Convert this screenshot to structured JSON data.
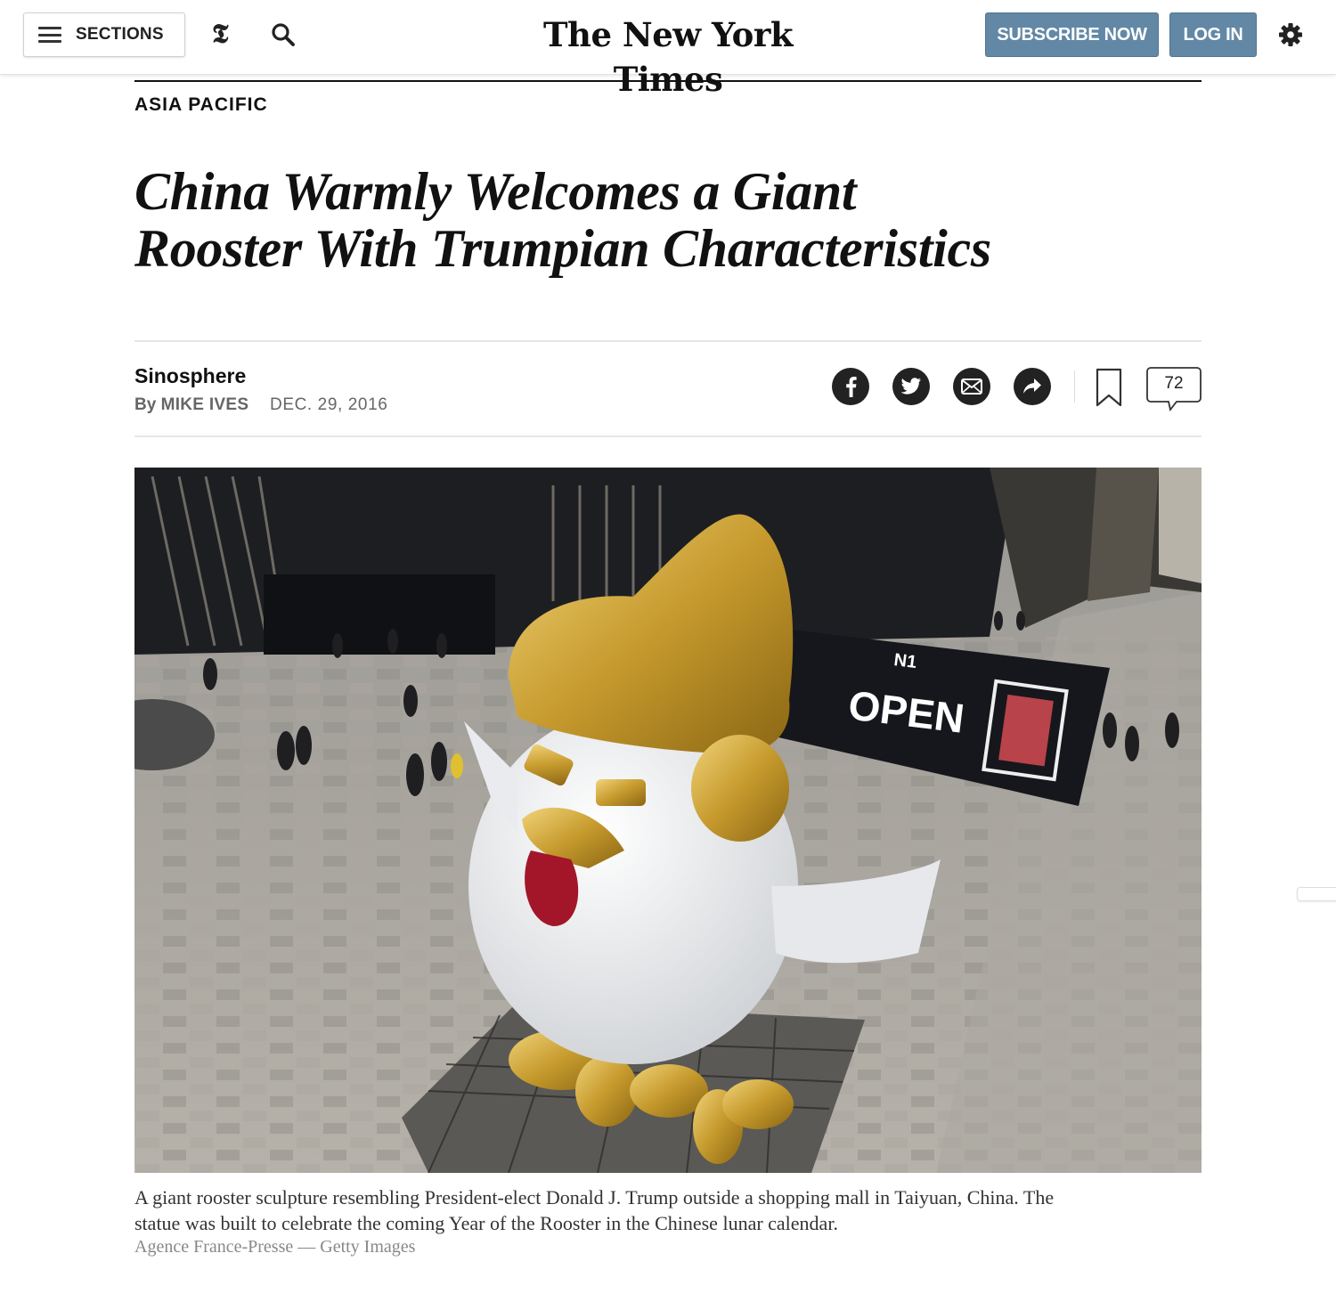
{
  "header": {
    "sections_label": "SECTIONS",
    "t_logo": "𝕿",
    "masthead_logo": "The New York Times",
    "subscribe_label": "SUBSCRIBE NOW",
    "login_label": "LOG IN",
    "icons": [
      "menu-icon",
      "search-icon",
      "gear-icon"
    ],
    "button_color": "#6288a5"
  },
  "article": {
    "kicker": "ASIA PACIFIC",
    "headline_line1": "China Warmly Welcomes a Giant",
    "headline_line2": "Rooster With Trumpian Characteristics",
    "blog_name": "Sinosphere",
    "byline_prefix": "By ",
    "author": "MIKE IVES",
    "date": "DEC. 29, 2016",
    "share_icons": [
      "facebook-icon",
      "twitter-icon",
      "email-icon",
      "share-icon"
    ],
    "comment_count": "72",
    "photo": {
      "alt_subject": "giant-rooster-statue",
      "banner_text": "OPEN",
      "banner_brand": "N1"
    },
    "caption": "A giant rooster sculpture resembling President-elect Donald J. Trump outside a shopping mall in Taiyuan, China. The statue was built to celebrate the coming Year of the Rooster in the Chinese lunar calendar.",
    "credit": "Agence France-Presse — Getty Images"
  }
}
